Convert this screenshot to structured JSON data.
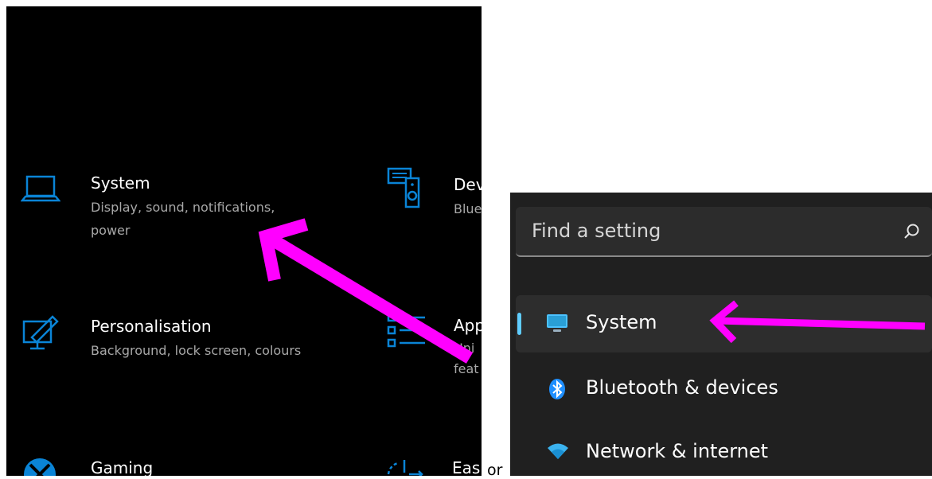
{
  "left_panel": {
    "items": [
      {
        "title": "System",
        "description": "Display, sound, notifications, power",
        "icon": "laptop-icon"
      },
      {
        "title": "Personalisation",
        "description": "Background, lock screen, colours",
        "icon": "personalisation-icon"
      },
      {
        "title": "Gaming",
        "description": "",
        "icon": "xbox-icon"
      },
      {
        "title": "Dev",
        "description": "Blue",
        "icon": "devices-icon"
      },
      {
        "title": "App",
        "description": "Uni feat",
        "icon": "apps-icon"
      },
      {
        "title": "Eas",
        "description": "",
        "icon": "ease-of-access-icon"
      }
    ]
  },
  "separator_text": "or",
  "right_panel": {
    "search": {
      "placeholder": "Find a setting",
      "icon": "search-icon"
    },
    "nav": [
      {
        "label": "System",
        "icon": "monitor-icon",
        "active": true
      },
      {
        "label": "Bluetooth & devices",
        "icon": "bluetooth-icon",
        "active": false
      },
      {
        "label": "Network & internet",
        "icon": "wifi-icon",
        "active": false
      }
    ]
  },
  "colors": {
    "accent_blue_w10": "#0a84d6",
    "accent_blue_w11": "#60cdff",
    "annotation_arrow": "#ff00ff"
  }
}
